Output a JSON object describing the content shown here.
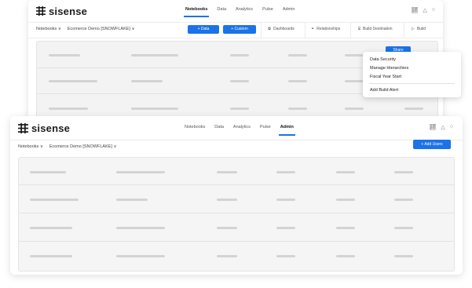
{
  "brand": {
    "name": "sisense",
    "accent": "#1a73e8"
  },
  "back_window": {
    "nav": [
      "Notebooks",
      "Data",
      "Analytics",
      "Pulse",
      "Admin"
    ],
    "active_tab": "Notebooks",
    "breadcrumb": [
      "Notebooks ∨",
      "Ecomerce Demo [SNOWFLAKE] ∨"
    ],
    "buttons": {
      "data": "+ Data",
      "custom": "+ Custom"
    },
    "toolbar": {
      "dashboards": "Dashboards",
      "relationships": "Relationships",
      "build_destination": "Build Destination",
      "build": "Build"
    },
    "share_label": "Share",
    "menu": {
      "items": [
        "Data Security",
        "Manage Hierarchies",
        "Fiscal Year Start"
      ],
      "footer_item": "Add Build Alert"
    }
  },
  "front_window": {
    "nav": [
      "Notebooks",
      "Data",
      "Analytics",
      "Pulse",
      "Admin"
    ],
    "active_tab": "Admin",
    "breadcrumb": [
      "Notebooks ∨",
      "Ecomerce Demo [SNOWFLAKE] ∨"
    ],
    "add_users": "+ Add Users"
  },
  "icons": [
    "sisense-logo-icon",
    "chart-icon",
    "bell-icon",
    "user-icon",
    "dashboard-icon",
    "relationships-icon",
    "database-icon",
    "play-icon"
  ]
}
